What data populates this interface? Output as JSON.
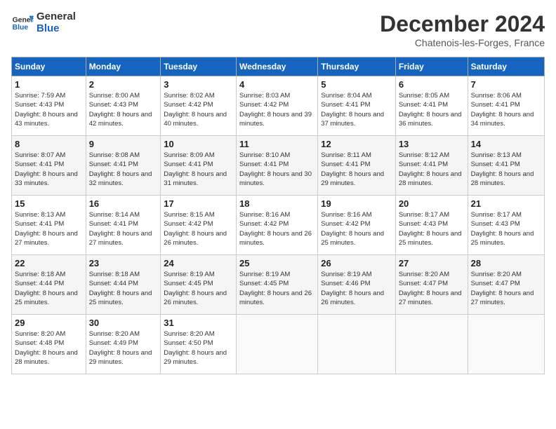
{
  "logo": {
    "line1": "General",
    "line2": "Blue"
  },
  "title": "December 2024",
  "subtitle": "Chatenois-les-Forges, France",
  "days_of_week": [
    "Sunday",
    "Monday",
    "Tuesday",
    "Wednesday",
    "Thursday",
    "Friday",
    "Saturday"
  ],
  "weeks": [
    [
      {
        "day": "1",
        "sunrise": "Sunrise: 7:59 AM",
        "sunset": "Sunset: 4:43 PM",
        "daylight": "Daylight: 8 hours and 43 minutes."
      },
      {
        "day": "2",
        "sunrise": "Sunrise: 8:00 AM",
        "sunset": "Sunset: 4:43 PM",
        "daylight": "Daylight: 8 hours and 42 minutes."
      },
      {
        "day": "3",
        "sunrise": "Sunrise: 8:02 AM",
        "sunset": "Sunset: 4:42 PM",
        "daylight": "Daylight: 8 hours and 40 minutes."
      },
      {
        "day": "4",
        "sunrise": "Sunrise: 8:03 AM",
        "sunset": "Sunset: 4:42 PM",
        "daylight": "Daylight: 8 hours and 39 minutes."
      },
      {
        "day": "5",
        "sunrise": "Sunrise: 8:04 AM",
        "sunset": "Sunset: 4:41 PM",
        "daylight": "Daylight: 8 hours and 37 minutes."
      },
      {
        "day": "6",
        "sunrise": "Sunrise: 8:05 AM",
        "sunset": "Sunset: 4:41 PM",
        "daylight": "Daylight: 8 hours and 36 minutes."
      },
      {
        "day": "7",
        "sunrise": "Sunrise: 8:06 AM",
        "sunset": "Sunset: 4:41 PM",
        "daylight": "Daylight: 8 hours and 34 minutes."
      }
    ],
    [
      {
        "day": "8",
        "sunrise": "Sunrise: 8:07 AM",
        "sunset": "Sunset: 4:41 PM",
        "daylight": "Daylight: 8 hours and 33 minutes."
      },
      {
        "day": "9",
        "sunrise": "Sunrise: 8:08 AM",
        "sunset": "Sunset: 4:41 PM",
        "daylight": "Daylight: 8 hours and 32 minutes."
      },
      {
        "day": "10",
        "sunrise": "Sunrise: 8:09 AM",
        "sunset": "Sunset: 4:41 PM",
        "daylight": "Daylight: 8 hours and 31 minutes."
      },
      {
        "day": "11",
        "sunrise": "Sunrise: 8:10 AM",
        "sunset": "Sunset: 4:41 PM",
        "daylight": "Daylight: 8 hours and 30 minutes."
      },
      {
        "day": "12",
        "sunrise": "Sunrise: 8:11 AM",
        "sunset": "Sunset: 4:41 PM",
        "daylight": "Daylight: 8 hours and 29 minutes."
      },
      {
        "day": "13",
        "sunrise": "Sunrise: 8:12 AM",
        "sunset": "Sunset: 4:41 PM",
        "daylight": "Daylight: 8 hours and 28 minutes."
      },
      {
        "day": "14",
        "sunrise": "Sunrise: 8:13 AM",
        "sunset": "Sunset: 4:41 PM",
        "daylight": "Daylight: 8 hours and 28 minutes."
      }
    ],
    [
      {
        "day": "15",
        "sunrise": "Sunrise: 8:13 AM",
        "sunset": "Sunset: 4:41 PM",
        "daylight": "Daylight: 8 hours and 27 minutes."
      },
      {
        "day": "16",
        "sunrise": "Sunrise: 8:14 AM",
        "sunset": "Sunset: 4:41 PM",
        "daylight": "Daylight: 8 hours and 27 minutes."
      },
      {
        "day": "17",
        "sunrise": "Sunrise: 8:15 AM",
        "sunset": "Sunset: 4:42 PM",
        "daylight": "Daylight: 8 hours and 26 minutes."
      },
      {
        "day": "18",
        "sunrise": "Sunrise: 8:16 AM",
        "sunset": "Sunset: 4:42 PM",
        "daylight": "Daylight: 8 hours and 26 minutes."
      },
      {
        "day": "19",
        "sunrise": "Sunrise: 8:16 AM",
        "sunset": "Sunset: 4:42 PM",
        "daylight": "Daylight: 8 hours and 25 minutes."
      },
      {
        "day": "20",
        "sunrise": "Sunrise: 8:17 AM",
        "sunset": "Sunset: 4:43 PM",
        "daylight": "Daylight: 8 hours and 25 minutes."
      },
      {
        "day": "21",
        "sunrise": "Sunrise: 8:17 AM",
        "sunset": "Sunset: 4:43 PM",
        "daylight": "Daylight: 8 hours and 25 minutes."
      }
    ],
    [
      {
        "day": "22",
        "sunrise": "Sunrise: 8:18 AM",
        "sunset": "Sunset: 4:44 PM",
        "daylight": "Daylight: 8 hours and 25 minutes."
      },
      {
        "day": "23",
        "sunrise": "Sunrise: 8:18 AM",
        "sunset": "Sunset: 4:44 PM",
        "daylight": "Daylight: 8 hours and 25 minutes."
      },
      {
        "day": "24",
        "sunrise": "Sunrise: 8:19 AM",
        "sunset": "Sunset: 4:45 PM",
        "daylight": "Daylight: 8 hours and 26 minutes."
      },
      {
        "day": "25",
        "sunrise": "Sunrise: 8:19 AM",
        "sunset": "Sunset: 4:45 PM",
        "daylight": "Daylight: 8 hours and 26 minutes."
      },
      {
        "day": "26",
        "sunrise": "Sunrise: 8:19 AM",
        "sunset": "Sunset: 4:46 PM",
        "daylight": "Daylight: 8 hours and 26 minutes."
      },
      {
        "day": "27",
        "sunrise": "Sunrise: 8:20 AM",
        "sunset": "Sunset: 4:47 PM",
        "daylight": "Daylight: 8 hours and 27 minutes."
      },
      {
        "day": "28",
        "sunrise": "Sunrise: 8:20 AM",
        "sunset": "Sunset: 4:47 PM",
        "daylight": "Daylight: 8 hours and 27 minutes."
      }
    ],
    [
      {
        "day": "29",
        "sunrise": "Sunrise: 8:20 AM",
        "sunset": "Sunset: 4:48 PM",
        "daylight": "Daylight: 8 hours and 28 minutes."
      },
      {
        "day": "30",
        "sunrise": "Sunrise: 8:20 AM",
        "sunset": "Sunset: 4:49 PM",
        "daylight": "Daylight: 8 hours and 29 minutes."
      },
      {
        "day": "31",
        "sunrise": "Sunrise: 8:20 AM",
        "sunset": "Sunset: 4:50 PM",
        "daylight": "Daylight: 8 hours and 29 minutes."
      },
      null,
      null,
      null,
      null
    ]
  ]
}
